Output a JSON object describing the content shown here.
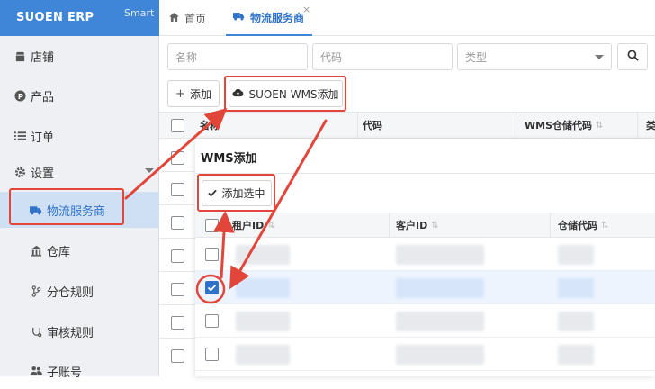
{
  "brand": {
    "name": "SUOEN ERP",
    "sub": "Smart"
  },
  "sidebar": {
    "items": [
      {
        "label": "店铺",
        "icon": "shop-icon"
      },
      {
        "label": "产品",
        "icon": "product-icon"
      },
      {
        "label": "订单",
        "icon": "list-icon"
      },
      {
        "label": "设置",
        "icon": "gear-icon"
      },
      {
        "label": "物流服务商",
        "icon": "truck-icon"
      },
      {
        "label": "仓库",
        "icon": "warehouse-icon"
      },
      {
        "label": "分仓规则",
        "icon": "branch-icon"
      },
      {
        "label": "审核规则",
        "icon": "audit-icon"
      },
      {
        "label": "子账号",
        "icon": "users-icon"
      }
    ]
  },
  "tabs": {
    "home": "首页",
    "logistics": "物流服务商",
    "close": "×"
  },
  "search": {
    "name_placeholder": "名称",
    "code_placeholder": "代码",
    "type_placeholder": "类型"
  },
  "toolbar": {
    "add_label": "添加",
    "wms_add_label": "SUOEN-WMS添加"
  },
  "grid": {
    "columns": [
      "名称",
      "代码",
      "WMS仓储代码",
      "类"
    ]
  },
  "modal": {
    "title": "WMS添加",
    "add_selected_label": "添加选中",
    "columns": [
      "租户ID",
      "客户ID",
      "仓储代码"
    ]
  },
  "colors": {
    "brand": "#3f86d8",
    "annotation": "#e2463a",
    "checked": "#2f73c9"
  }
}
